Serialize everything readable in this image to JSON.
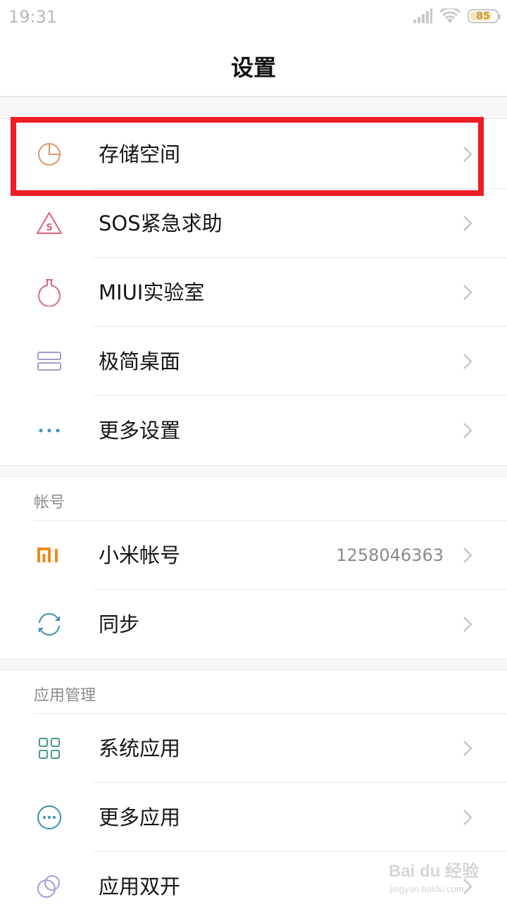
{
  "status_bar": {
    "time": "19:31",
    "battery_level": "85",
    "battery_fraction": 0.85,
    "icons": [
      "signal-icon",
      "wifi-icon",
      "battery-icon"
    ]
  },
  "header": {
    "title": "设置"
  },
  "group1": {
    "items": [
      {
        "label": "存储空间",
        "icon": "storage-pie-icon",
        "icon_color": "#e0956a"
      },
      {
        "label": "SOS紧急求助",
        "icon": "sos-warning-icon",
        "icon_color": "#e05f7a"
      },
      {
        "label": "MIUI实验室",
        "icon": "flask-icon",
        "icon_color": "#d9678a"
      },
      {
        "label": "极简桌面",
        "icon": "simple-desktop-icon",
        "icon_color": "#a79ad4"
      },
      {
        "label": "更多设置",
        "icon": "more-dots-icon",
        "icon_color": "#3c8fc4"
      }
    ]
  },
  "account": {
    "section_title": "帐号",
    "items": [
      {
        "label": "小米帐号",
        "value": "1258046363",
        "icon": "mi-logo-icon",
        "icon_color": "#f08a1d"
      },
      {
        "label": "同步",
        "icon": "sync-icon",
        "icon_color": "#3a8fb8"
      }
    ]
  },
  "apps": {
    "section_title": "应用管理",
    "items": [
      {
        "label": "系统应用",
        "icon": "grid-apps-icon",
        "icon_color": "#4a9a8a"
      },
      {
        "label": "更多应用",
        "icon": "more-circle-icon",
        "icon_color": "#3a8fb8"
      },
      {
        "label": "应用双开",
        "icon": "dual-apps-icon",
        "icon_color": "#a99ad8"
      }
    ]
  },
  "watermark": {
    "brand": "Bai du 经验",
    "url": "jingyan.baidu.com"
  },
  "colors": {
    "highlight": "#ee1c25",
    "divider": "#e6e6e6",
    "chevron": "#bdbdbd"
  }
}
